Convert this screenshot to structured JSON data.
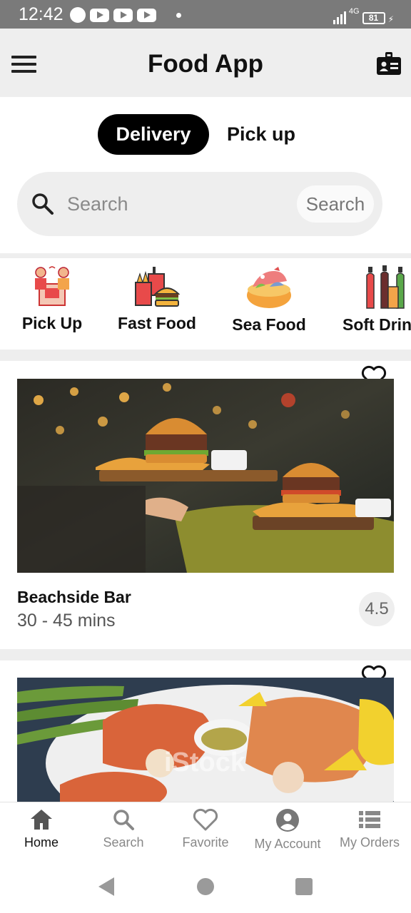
{
  "status_bar": {
    "time": "12:42",
    "network": "4G",
    "battery": "81"
  },
  "app_bar": {
    "title": "Food App"
  },
  "order_mode": {
    "selected": "Delivery",
    "options": [
      "Delivery",
      "Pick up"
    ]
  },
  "search": {
    "placeholder": "Search",
    "button_label": "Search"
  },
  "categories": [
    {
      "label": "Pick Up",
      "icon": "pickup-icon"
    },
    {
      "label": "Fast Food",
      "icon": "fast-food-icon"
    },
    {
      "label": "Sea Food",
      "icon": "sea-food-icon"
    },
    {
      "label": "Soft Drin",
      "icon": "soft-drinks-icon"
    }
  ],
  "restaurants": [
    {
      "name": "Beachside Bar",
      "delivery_time": "30 - 45 mins",
      "rating": "4.5",
      "image": "burger-and-fries-photo",
      "favorite": false
    },
    {
      "image": "seafood-platter-photo",
      "favorite": false,
      "watermark": "iStock"
    }
  ],
  "bottom_nav": [
    {
      "label": "Home",
      "icon": "home-icon",
      "active": true
    },
    {
      "label": "Search",
      "icon": "search-icon",
      "active": false
    },
    {
      "label": "Favorite",
      "icon": "heart-icon",
      "active": false
    },
    {
      "label": "My Account",
      "icon": "account-circle-icon",
      "active": false
    },
    {
      "label": "My Orders",
      "icon": "list-icon",
      "active": false
    }
  ],
  "colors": {
    "app_bar_bg": "#eeeeee",
    "toggle_active_bg": "#000000",
    "search_bg": "#eeeeee",
    "status_bar_bg": "#7a7a7a",
    "nav_active": "#111111",
    "nav_inactive": "#888888"
  }
}
